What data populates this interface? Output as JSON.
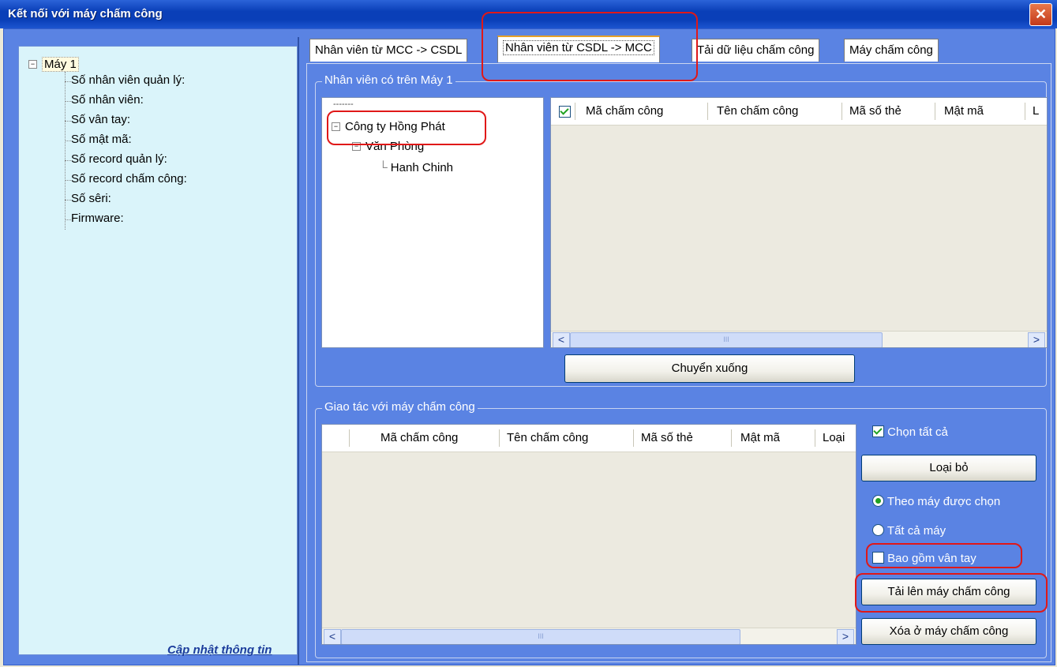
{
  "window": {
    "title": "Kết nối với máy chấm công",
    "close_glyph": "✕"
  },
  "left_tree": {
    "root_label": "Máy 1",
    "items": [
      "Số nhân viên quản lý:",
      "Số nhân viên:",
      "Số vân tay:",
      "Số mật mã:",
      "Số record quản lý:",
      "Số record chấm công:",
      "Số sêri:",
      "Firmware:"
    ],
    "update_link": "Cập nhật thông tin"
  },
  "tabs": [
    {
      "label": "Nhân viên từ MCC -> CSDL",
      "active": false
    },
    {
      "label": "Nhân viên từ CSDL -> MCC",
      "active": true
    },
    {
      "label": "Tải dữ liệu chấm công",
      "active": false
    },
    {
      "label": "Máy chấm công",
      "active": false
    }
  ],
  "employees_group": {
    "title": "Nhân viên có trên Máy 1",
    "org_tree": {
      "root_dots": "-------",
      "company": "Công ty Hồng Phát",
      "department": "Văn Phòng",
      "sub_department": "Hanh Chinh"
    },
    "columns": [
      "Mã chấm công",
      "Tên chấm công",
      "Mã số thẻ",
      "Mật mã",
      "L"
    ],
    "move_down_button": "Chuyển xuống"
  },
  "machine_group": {
    "title": "Giao tác với máy chấm công",
    "columns": [
      "Mã chấm công",
      "Tên chấm công",
      "Mã số thẻ",
      "Mật mã",
      "Loại"
    ],
    "select_all": {
      "label": "Chọn tất cả",
      "checked": true
    },
    "remove_button": "Loại bỏ",
    "radio_selected_machine": {
      "label": "Theo máy được chọn",
      "selected": true
    },
    "radio_all_machines": {
      "label": "Tất cả máy",
      "selected": false
    },
    "include_fingerprint": {
      "label": "Bao gồm vân tay",
      "checked": false
    },
    "upload_button": "Tải lên máy chấm công",
    "delete_button": "Xóa ở máy chấm công"
  },
  "scroll_icons": {
    "left": "<",
    "right": ">",
    "thumb": "III"
  },
  "colors": {
    "panel_blue": "#5a83e3",
    "annotation_red": "#e01818",
    "title_blue": "#0a3fb8"
  }
}
